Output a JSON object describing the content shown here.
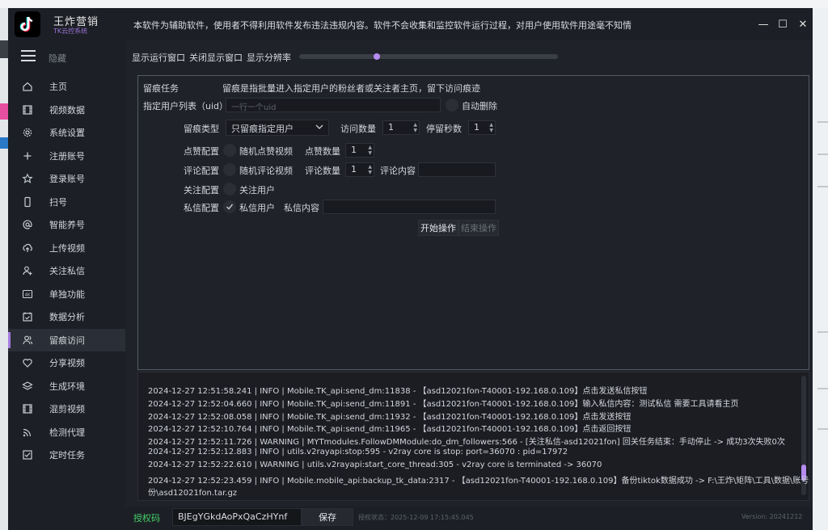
{
  "app": {
    "name": "王炸营销",
    "subtitle": "TK云控系统",
    "notice": "本软件为辅助软件，使用者不得利用软件发布违法违规内容。软件不会收集和监控软件运行过程，对用户使用软件用途毫不知情"
  },
  "window": {
    "minimize": "—",
    "maximize": "☐",
    "close": "✕"
  },
  "sidebar": {
    "hide_label": "隐藏",
    "items": [
      {
        "label": "主页",
        "icon": "home-icon"
      },
      {
        "label": "视频数据",
        "icon": "film-icon"
      },
      {
        "label": "系统设置",
        "icon": "gear-icon"
      },
      {
        "label": "注册账号",
        "icon": "plus-icon"
      },
      {
        "label": "登录账号",
        "icon": "star-icon"
      },
      {
        "label": "扫号",
        "icon": "phone-icon"
      },
      {
        "label": "智能养号",
        "icon": "at-icon"
      },
      {
        "label": "上传视频",
        "icon": "upload-cloud-icon"
      },
      {
        "label": "关注私信",
        "icon": "user-add-icon"
      },
      {
        "label": "单独功能",
        "icon": "4k-icon"
      },
      {
        "label": "数据分析",
        "icon": "calendar-check-icon"
      },
      {
        "label": "留痕访问",
        "icon": "users-icon",
        "active": true
      },
      {
        "label": "分享视频",
        "icon": "heart-icon"
      },
      {
        "label": "生成环境",
        "icon": "layers-icon"
      },
      {
        "label": "混剪视频",
        "icon": "film-icon"
      },
      {
        "label": "检测代理",
        "icon": "rss-icon"
      },
      {
        "label": "定时任务",
        "icon": "checklist-icon"
      }
    ]
  },
  "toolbar": {
    "show_window": "显示运行窗口",
    "hide_window": "关闭显示窗口",
    "resolution": "显示分辨率",
    "resolution_value": 0.3
  },
  "task": {
    "title": "留痕任务",
    "description": "留痕是指批量进入指定用户的粉丝者或关注者主页，留下访问痕迹",
    "uid_label": "指定用户列表（uid）",
    "uid_placeholder": "一行一个uid",
    "auto_delete": "自动删除",
    "type_label": "留痕类型",
    "type_value": "只留痕指定用户",
    "visit_count_label": "访问数量",
    "visit_count": "1",
    "stay_seconds_label": "停留秒数",
    "stay_seconds": "1",
    "like_config_label": "点赞配置",
    "like_random": "随机点赞视频",
    "like_count_label": "点赞数量",
    "like_count": "1",
    "comment_config_label": "评论配置",
    "comment_random": "随机评论视频",
    "comment_count_label": "评论数量",
    "comment_count": "1",
    "comment_content_label": "评论内容",
    "follow_config_label": "关注配置",
    "follow_user": "关注用户",
    "dm_config_label": "私信配置",
    "dm_user": "私信用户",
    "dm_content_label": "私信内容",
    "start_button": "开始操作",
    "stop_button": "结束操作"
  },
  "log": {
    "lines": [
      "2024-12-27 12:51:58.241 | INFO    | Mobile.TK_api:send_dm:11838 - 【asd12021fon-T40001-192.168.0.109】点击发送私信按钮",
      "2024-12-27 12:52:04.660 | INFO    | Mobile.TK_api:send_dm:11891 - 【asd12021fon-T40001-192.168.0.109】输入私信内容：测试私信 需要工具请看主页",
      "2024-12-27 12:52:08.058 | INFO    | Mobile.TK_api:send_dm:11932 - 【asd12021fon-T40001-192.168.0.109】点击发送按钮",
      "2024-12-27 12:52:10.764 | INFO    | Mobile.TK_api:send_dm:11965 - 【asd12021fon-T40001-192.168.0.109】点击返回按钮",
      "2024-12-27 12:52:11.726 | WARNING | MYTmodules.FollowDMModule:do_dm_followers:566 - [关注私信-asd12021fon] 回关任务结束：手动停止 -> 成功3次失败0次",
      "2024-12-27 12:52:12.883 | INFO    | utils.v2rayapi:stop:595 - v2ray core is stop: port=36070 : pid=17972",
      "2024-12-27 12:52:22.610 | WARNING | utils.v2rayapi:start_core_thread:305 - v2ray core is terminated -> 36070",
      "2024-12-27 12:52:23.459 | INFO    | Mobile.mobile_api:backup_tk_data:2317 - 【asd12021fon-T40001-192.168.0.109】备份tiktok数据成功 -> F:\\王炸\\矩阵\\工具\\数据\\账号备",
      "份\\asd12021fon.tar.gz"
    ]
  },
  "footer": {
    "license_label": "授权码",
    "license_code": "BJEgYGkdAoPxQaCzHYnf",
    "save_button": "保存",
    "auth_status": "授权状态：2025-12-09 17:15:45.045",
    "version": "Version: 20241212"
  }
}
